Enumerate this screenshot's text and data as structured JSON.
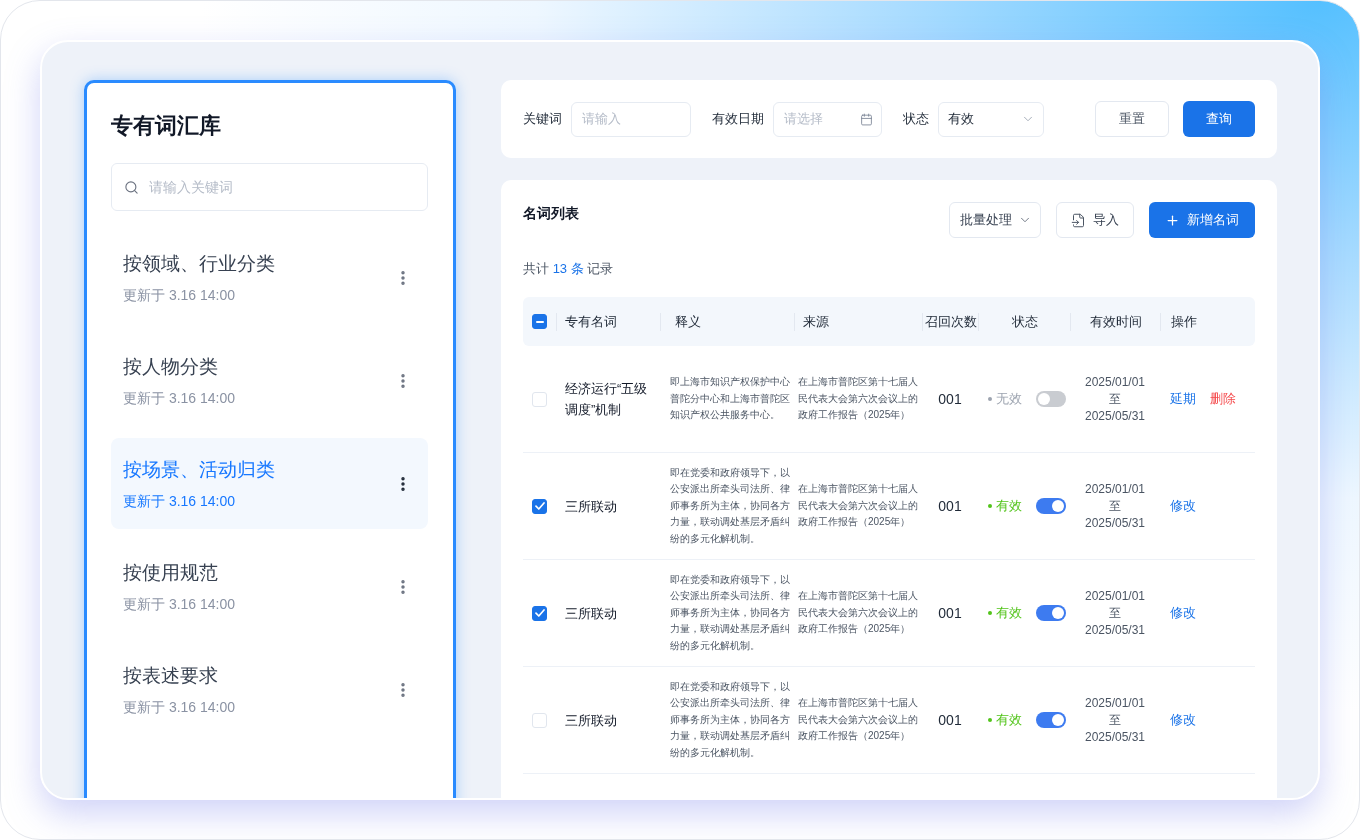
{
  "sidebar": {
    "title": "专有词汇库",
    "search": {
      "placeholder": "请输入关键词"
    },
    "items": [
      {
        "title": "按领域、行业分类",
        "updated": "更新于 3.16 14:00",
        "selected": false
      },
      {
        "title": "按人物分类",
        "updated": "更新于 3.16 14:00",
        "selected": false
      },
      {
        "title": "按场景、活动归类",
        "updated": "更新于 3.16 14:00",
        "selected": true
      },
      {
        "title": "按使用规范",
        "updated": "更新于 3.16 14:00",
        "selected": false
      },
      {
        "title": "按表述要求",
        "updated": "更新于 3.16 14:00",
        "selected": false
      }
    ]
  },
  "filters": {
    "fields": [
      {
        "kind": "text",
        "label": "关键词",
        "placeholder": "请输入"
      },
      {
        "kind": "date",
        "label": "有效日期",
        "placeholder": "请选择"
      },
      {
        "kind": "select",
        "label": "状态",
        "value": "有效"
      }
    ],
    "buttons": [
      {
        "kind": "default",
        "label": "重置"
      },
      {
        "kind": "primary",
        "label": "查询"
      }
    ]
  },
  "list": {
    "title": "名词列表",
    "actions": [
      {
        "kind": "dropdown",
        "label": "批量处理"
      },
      {
        "kind": "import",
        "label": "导入"
      },
      {
        "kind": "add",
        "label": "新增名词"
      }
    ],
    "summary": {
      "before": "共计",
      "count": "13 条",
      "after": "记录"
    },
    "table": {
      "select_all": {
        "indeterminate": true
      },
      "columns": [
        "专有名词",
        "释义",
        "来源",
        "召回次数",
        "状态",
        "有效时间",
        "操作"
      ],
      "rows": [
        {
          "checked": false,
          "name": "经济运行“五级调度”机制",
          "definition": "即上海市知识产权保护中心普陀分中心和上海市普陀区知识产权公共服务中心。",
          "source": "在上海市普陀区第十七届人民代表大会第六次会议上的政府工作报告（2025年）",
          "recall_count": "001",
          "status": "无效",
          "valid": false,
          "enabled": false,
          "valid_from": "2025/01/01",
          "to": "至",
          "valid_until": "2025/05/31",
          "actions": [
            {
              "kind": "link",
              "label": "延期"
            },
            {
              "kind": "danger",
              "label": "删除"
            }
          ]
        },
        {
          "checked": true,
          "name": "三所联动",
          "definition": "即在党委和政府领导下，以公安派出所牵头司法所、律师事务所为主体，协同各方力量，联动调处基层矛盾纠纷的多元化解机制。",
          "source": "在上海市普陀区第十七届人民代表大会第六次会议上的政府工作报告（2025年）",
          "recall_count": "001",
          "status": "有效",
          "valid": true,
          "enabled": true,
          "valid_from": "2025/01/01",
          "to": "至",
          "valid_until": "2025/05/31",
          "actions": [
            {
              "kind": "link",
              "label": "修改"
            }
          ]
        },
        {
          "checked": true,
          "name": "三所联动",
          "definition": "即在党委和政府领导下，以公安派出所牵头司法所、律师事务所为主体，协同各方力量，联动调处基层矛盾纠纷的多元化解机制。",
          "source": "在上海市普陀区第十七届人民代表大会第六次会议上的政府工作报告（2025年）",
          "recall_count": "001",
          "status": "有效",
          "valid": true,
          "enabled": true,
          "valid_from": "2025/01/01",
          "to": "至",
          "valid_until": "2025/05/31",
          "actions": [
            {
              "kind": "link",
              "label": "修改"
            }
          ]
        },
        {
          "checked": false,
          "name": "三所联动",
          "definition": "即在党委和政府领导下，以公安派出所牵头司法所、律师事务所为主体，协同各方力量，联动调处基层矛盾纠纷的多元化解机制。",
          "source": "在上海市普陀区第十七届人民代表大会第六次会议上的政府工作报告（2025年）",
          "recall_count": "001",
          "status": "有效",
          "valid": true,
          "enabled": true,
          "valid_from": "2025/01/01",
          "to": "至",
          "valid_until": "2025/05/31",
          "actions": [
            {
              "kind": "link",
              "label": "修改"
            }
          ]
        }
      ]
    }
  }
}
